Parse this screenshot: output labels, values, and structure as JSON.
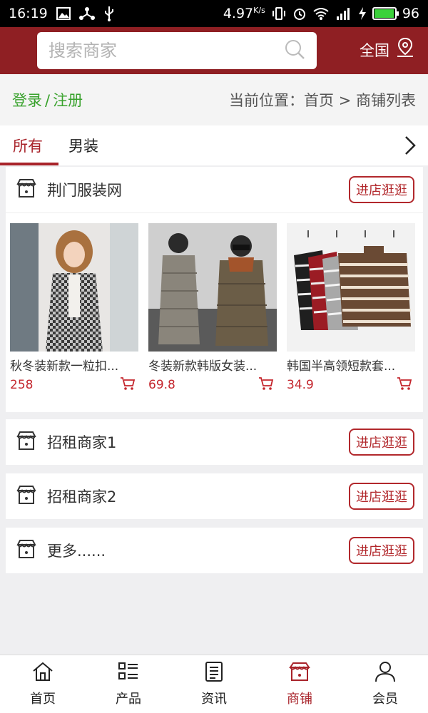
{
  "status_bar": {
    "time": "16:19",
    "speed": "4.97",
    "speed_unit": "K/s",
    "battery": "96",
    "battery_level": 0.96
  },
  "header": {
    "search_placeholder": "搜索商家",
    "region_label": "全国"
  },
  "breadcrumb": {
    "login": "登录",
    "separator": "/",
    "register": "注册",
    "location": "当前位置：首页 > 商铺列表"
  },
  "tabs": [
    {
      "label": "所有",
      "active": true
    },
    {
      "label": "男装",
      "active": false
    }
  ],
  "shops": [
    {
      "name": "荆门服装网",
      "enter_label": "进店逛逛",
      "products": [
        {
          "title": "秋冬装新款一粒扣...",
          "price": "258"
        },
        {
          "title": "冬装新款韩版女装...",
          "price": "69.8"
        },
        {
          "title": "韩国半高领短款套...",
          "price": "34.9"
        }
      ]
    },
    {
      "name": "招租商家1",
      "enter_label": "进店逛逛"
    },
    {
      "name": "招租商家2",
      "enter_label": "进店逛逛"
    },
    {
      "name": "更多......",
      "enter_label": "进店逛逛"
    }
  ],
  "bottom_nav": [
    {
      "label": "首页",
      "icon": "home-icon"
    },
    {
      "label": "产品",
      "icon": "grid-list-icon"
    },
    {
      "label": "资讯",
      "icon": "news-icon"
    },
    {
      "label": "商铺",
      "icon": "shop-icon",
      "active": true
    },
    {
      "label": "会员",
      "icon": "user-icon"
    }
  ],
  "colors": {
    "brand": "#8f1f23",
    "accent": "#a8232a",
    "login_green": "#39a22d",
    "price_red": "#c4262d"
  }
}
